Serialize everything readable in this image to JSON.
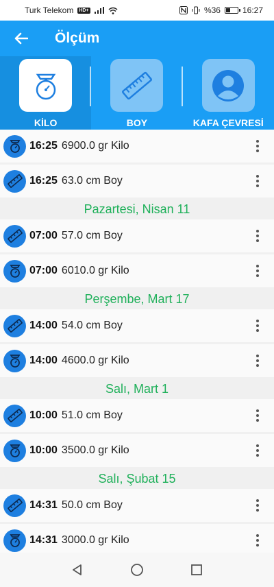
{
  "status": {
    "carrier": "Turk Telekom",
    "hd": "HD+",
    "battery": "%36",
    "time": "16:27"
  },
  "appbar": {
    "title": "Ölçüm",
    "back_icon": "arrow-left-icon"
  },
  "tabs": [
    {
      "label": "KİLO",
      "icon": "scale-icon",
      "active": true
    },
    {
      "label": "BOY",
      "icon": "ruler-icon",
      "active": false
    },
    {
      "label": "KAFA ÇEVRESİ",
      "icon": "person-icon",
      "active": false
    }
  ],
  "list": {
    "group0": [
      {
        "type": "kilo",
        "time": "16:25",
        "value": "6900.0 gr Kilo"
      },
      {
        "type": "boy",
        "time": "16:25",
        "value": "63.0 cm Boy"
      }
    ],
    "headers": [
      "Pazartesi, Nisan 11",
      "Perşembe, Mart 17",
      "Salı, Mart 1",
      "Salı, Şubat 15"
    ],
    "group1": [
      {
        "type": "boy",
        "time": "07:00",
        "value": "57.0 cm Boy"
      },
      {
        "type": "kilo",
        "time": "07:00",
        "value": "6010.0 gr Kilo"
      }
    ],
    "group2": [
      {
        "type": "boy",
        "time": "14:00",
        "value": "54.0 cm Boy"
      },
      {
        "type": "kilo",
        "time": "14:00",
        "value": "4600.0 gr Kilo"
      }
    ],
    "group3": [
      {
        "type": "boy",
        "time": "10:00",
        "value": "51.0 cm Boy"
      },
      {
        "type": "kilo",
        "time": "10:00",
        "value": "3500.0 gr Kilo"
      }
    ],
    "group4": [
      {
        "type": "boy",
        "time": "14:31",
        "value": "50.0 cm Boy"
      },
      {
        "type": "kilo",
        "time": "14:31",
        "value": "3000.0 gr Kilo"
      }
    ]
  },
  "colors": {
    "primary": "#1a9ef5",
    "accent_green": "#1fb05a",
    "icon_circle": "#1e7fe0"
  }
}
